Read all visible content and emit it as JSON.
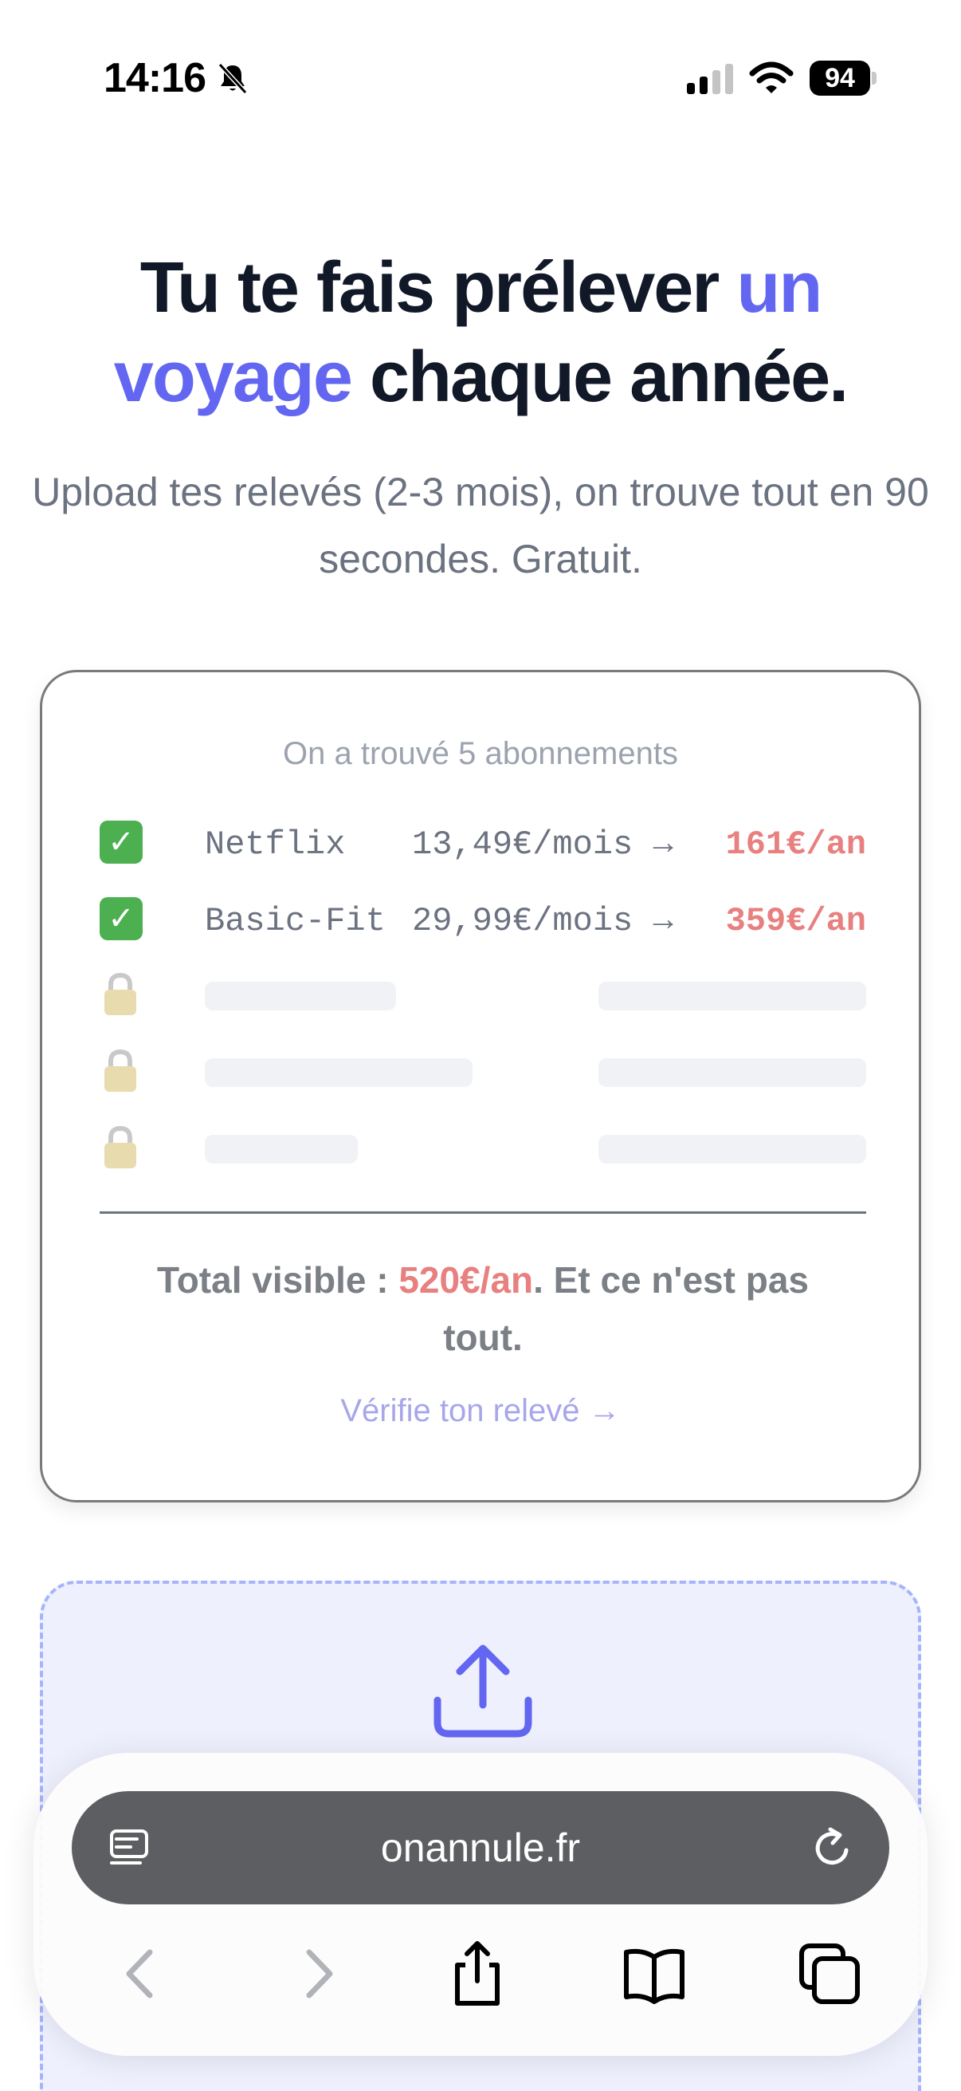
{
  "status_bar": {
    "time": "14:16",
    "battery": "94"
  },
  "hero": {
    "headline_part1": "Tu te fais prélever ",
    "headline_accent1": "un",
    "headline_accent2": "voyage",
    "headline_part2": " chaque année.",
    "subhead": "Upload tes relevés (2-3 mois), on trouve tout en 90 secondes. Gratuit."
  },
  "card": {
    "header": "On a trouvé 5 abonnements",
    "items": [
      {
        "name": "Netflix",
        "monthly": "13,49€/mois →",
        "yearly": "161€/an"
      },
      {
        "name": "Basic-Fit",
        "monthly": "29,99€/mois →",
        "yearly": "359€/an"
      }
    ],
    "locked_count": 3,
    "total_label": "Total visible : ",
    "total_amount": "520€/an",
    "total_suffix": ". Et ce n'est pas tout.",
    "cta": "Vérifie ton relevé →"
  },
  "browser": {
    "url": "onannule.fr"
  },
  "colors": {
    "accent": "#6366f1",
    "price_red": "#e88080",
    "upload_bg": "#eff0fe"
  },
  "icons": [
    "bell-slash-icon",
    "cellular-signal-icon",
    "wifi-icon",
    "battery-icon",
    "check-icon",
    "lock-icon",
    "upload-icon",
    "reader-icon",
    "reload-icon",
    "back-icon",
    "forward-icon",
    "share-icon",
    "bookmarks-icon",
    "tabs-icon"
  ]
}
